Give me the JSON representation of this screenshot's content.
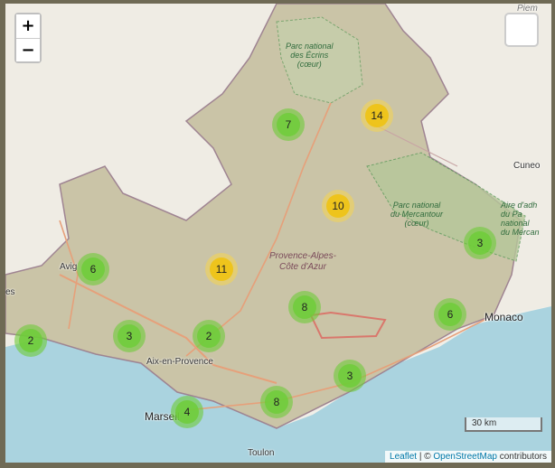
{
  "map": {
    "zoom_in_label": "+",
    "zoom_out_label": "−",
    "region_label": [
      "Provence-Alpes-",
      "Côte d'Azur"
    ],
    "places": {
      "piem": "Piem",
      "ecrins": [
        "Parc national",
        "des Écrins",
        "(cœur)"
      ],
      "mercantour": [
        "Parc national",
        "du Mercantour",
        "(cœur)"
      ],
      "aire": [
        "Aire d'adh",
        "du Pa",
        "national",
        "du Mercan"
      ],
      "cuneo": "Cuneo",
      "avignon": "Avig",
      "es": "es",
      "monaco": "Monaco",
      "aix": "Aix-en-Provence",
      "marseille": "Marseil",
      "toulon": "Toulon"
    },
    "clusters": [
      {
        "count": "7",
        "size": "small"
      },
      {
        "count": "14",
        "size": "medium"
      },
      {
        "count": "10",
        "size": "medium"
      },
      {
        "count": "3",
        "size": "small"
      },
      {
        "count": "6",
        "size": "small"
      },
      {
        "count": "11",
        "size": "medium"
      },
      {
        "count": "8",
        "size": "small"
      },
      {
        "count": "6",
        "size": "small"
      },
      {
        "count": "2",
        "size": "small"
      },
      {
        "count": "3",
        "size": "small"
      },
      {
        "count": "2",
        "size": "small"
      },
      {
        "count": "3",
        "size": "small"
      },
      {
        "count": "8",
        "size": "small"
      },
      {
        "count": "4",
        "size": "small"
      }
    ],
    "scale_label": "30 km",
    "attribution": {
      "leaflet": "Leaflet",
      "sep": " | © ",
      "osm": "OpenStreetMap",
      "contrib": " contributors"
    }
  }
}
